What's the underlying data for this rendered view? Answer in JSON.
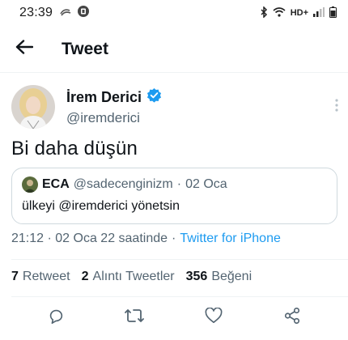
{
  "status_bar": {
    "time": "23:39",
    "network_label": "HD+",
    "icons": [
      "cloud-icon",
      "notification-badge-icon",
      "bluetooth-icon",
      "wifi-icon",
      "signal-icon",
      "battery-icon"
    ]
  },
  "header": {
    "title": "Tweet",
    "back_icon": "arrow-left-icon"
  },
  "tweet": {
    "author_name": "İrem Derici",
    "author_handle": "@iremderici",
    "verified": true,
    "text": "Bi daha düşün",
    "quote": {
      "author_name": "ECA",
      "author_handle": "@sadecenginizm",
      "separator": "·",
      "date": "02 Oca",
      "text": "ülkeyi @iremderici yönetsin"
    },
    "timestamp": {
      "time_text": "21:12 · 02 Oca 22 saatinde",
      "separator": "·",
      "source": "Twitter for iPhone"
    },
    "stats": {
      "retweets_count": "7",
      "retweets_label": "Retweet",
      "quotes_count": "2",
      "quotes_label": "Alıntı Tweetler",
      "likes_count": "356",
      "likes_label": "Beğeni"
    }
  },
  "actions": [
    "reply-icon",
    "retweet-icon",
    "like-icon",
    "share-icon"
  ],
  "colors": {
    "accent": "#1d9bf0",
    "text_primary": "#0f1419",
    "text_secondary": "#536471",
    "border": "#cfd9de",
    "divider": "#eff3f4"
  }
}
